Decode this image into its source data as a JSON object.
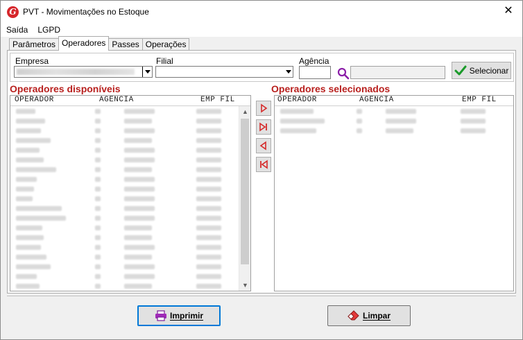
{
  "window": {
    "title": "PVT - Movimentações no Estoque",
    "close_glyph": "✕",
    "app_icon_letter": "G"
  },
  "menu": [
    "Saída",
    "LGPD"
  ],
  "tabs": [
    {
      "label": "Parâmetros",
      "active": false
    },
    {
      "label": "Operadores",
      "active": true
    },
    {
      "label": "Passes",
      "active": false
    },
    {
      "label": "Operações",
      "active": false
    }
  ],
  "filters": {
    "empresa_label": "Empresa",
    "filial_label": "Filial",
    "agencia_label": "Agência",
    "selecionar_label": "Selecionar"
  },
  "available": {
    "title": "Operadores disponíveis",
    "columns": [
      "OPERADOR",
      "AGÊNCIA",
      "EMP FIL"
    ]
  },
  "selected": {
    "title": "Operadores selecionados",
    "columns": [
      "OPERADOR",
      "AGÊNCIA",
      "EMP FIL"
    ]
  },
  "footer": {
    "print_label": "Imprimir",
    "clear_label": "Limpar"
  },
  "colors": {
    "section_title": "#b8201e",
    "move_arrow": "#d62a2a",
    "accent": "#0078d7"
  }
}
